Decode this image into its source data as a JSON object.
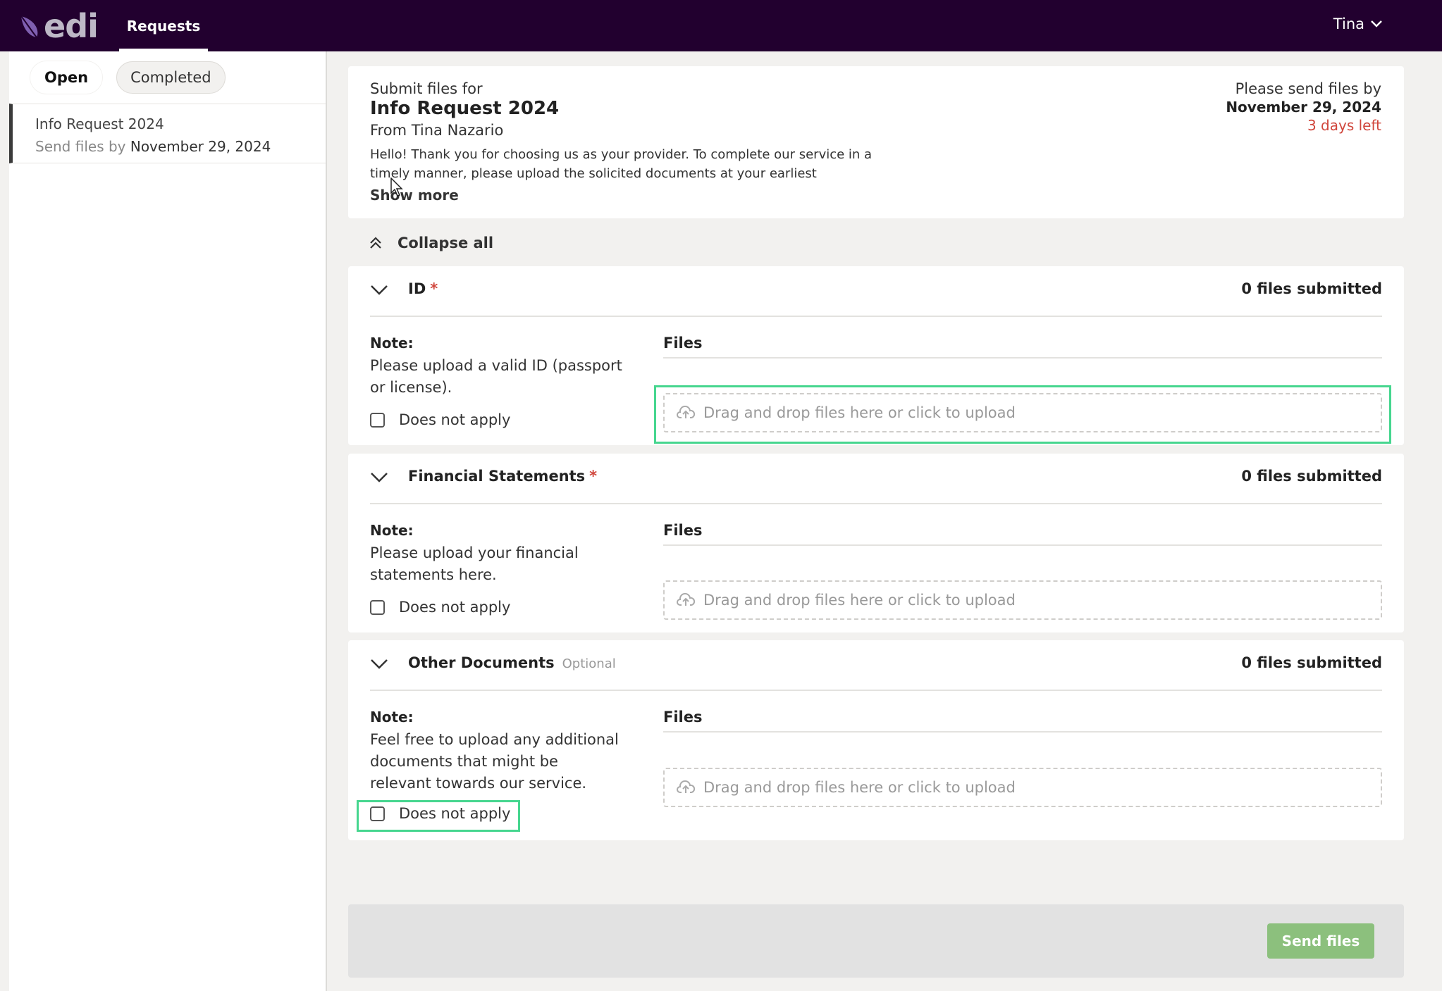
{
  "nav": {
    "logo_text": "edi",
    "requests_tab": "Requests",
    "user_name": "Tina"
  },
  "sidebar": {
    "filters": [
      {
        "label": "Open",
        "active": true
      },
      {
        "label": "Completed",
        "active": false
      }
    ],
    "items": [
      {
        "title": "Info Request 2024",
        "due_prefix": "Send files by",
        "due_date": "November 29, 2024"
      }
    ]
  },
  "request": {
    "kicker": "Submit files for",
    "title": "Info Request 2024",
    "from": "From Tina Nazario",
    "message": "Hello! Thank you for choosing us as your provider. To complete our service in a timely manner, please upload the solicited documents at your earliest",
    "show_more": "Show more",
    "due_label": "Please send files by",
    "due_date": "November 29, 2024",
    "days_left": "3 days left"
  },
  "collapse_all": "Collapse all",
  "sections": [
    {
      "title": "ID",
      "required_mark": "*",
      "files_count": "0 files submitted",
      "note_label": "Note:",
      "note": "Please upload a valid ID (passport or license).",
      "does_not_apply": "Does not apply",
      "files_label": "Files",
      "dropzone": "Drag and drop files here or click to upload"
    },
    {
      "title": "Financial Statements",
      "required_mark": "*",
      "files_count": "0 files submitted",
      "note_label": "Note:",
      "note": "Please upload your financial statements here.",
      "does_not_apply": "Does not apply",
      "files_label": "Files",
      "dropzone": "Drag and drop files here or click to upload"
    },
    {
      "title": "Other Documents",
      "optional_label": "Optional",
      "files_count": "0 files submitted",
      "note_label": "Note:",
      "note": "Feel free to upload any additional documents that might be relevant towards our service.",
      "does_not_apply": "Does not apply",
      "files_label": "Files",
      "dropzone": "Drag and drop files here or click to upload"
    }
  ],
  "actions": {
    "send_files": "Send files"
  },
  "colors": {
    "topbar": "#22002f",
    "required": "#d0463c",
    "send_button": "#8cc07d",
    "highlight": "#46d68f"
  }
}
